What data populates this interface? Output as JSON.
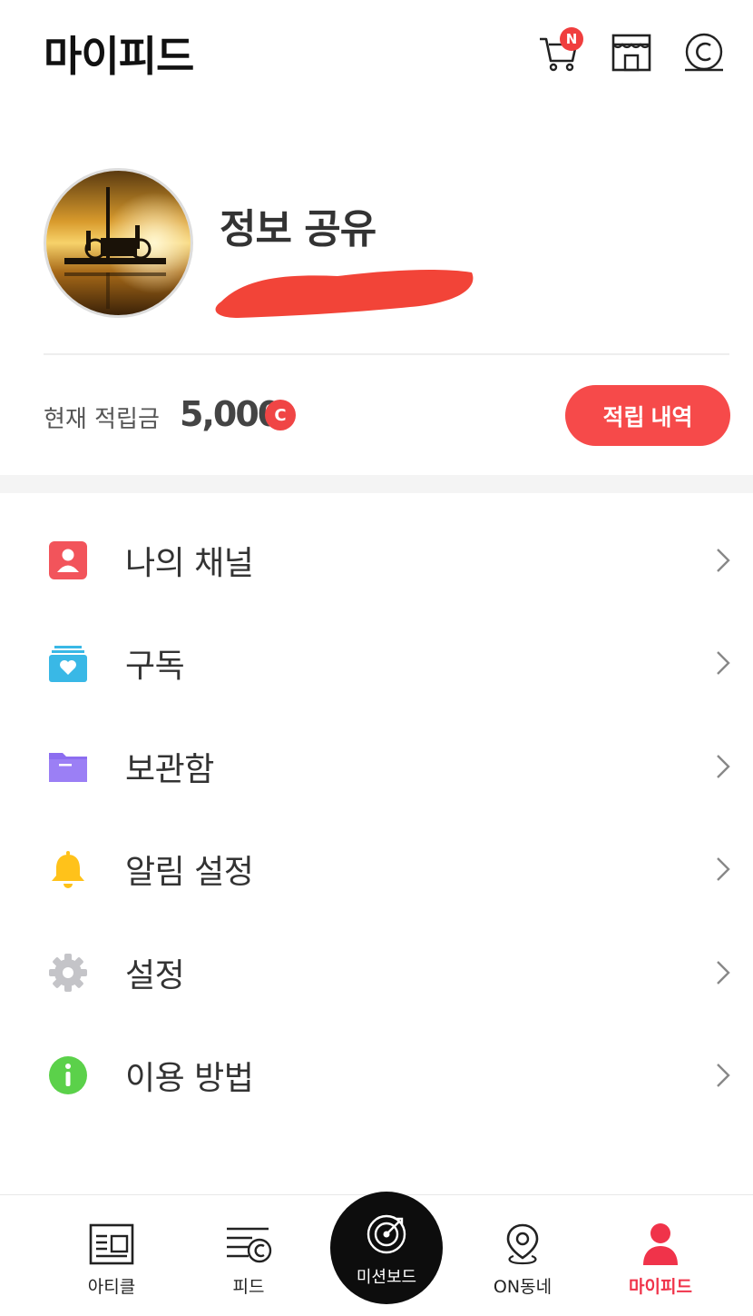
{
  "header": {
    "title": "마이피드",
    "cart_badge": "N",
    "icons": [
      "cart-icon",
      "store-icon",
      "coin-icon"
    ]
  },
  "profile": {
    "name": "정보 공유"
  },
  "points": {
    "label": "현재 적립금",
    "value": "5,000",
    "coin_symbol": "C",
    "history_button": "적립 내역"
  },
  "menu": {
    "items": [
      {
        "label": "나의 채널",
        "icon": "my-channel-icon",
        "color": "#f2545b"
      },
      {
        "label": "구독",
        "icon": "subscribe-icon",
        "color": "#39b8e6"
      },
      {
        "label": "보관함",
        "icon": "folder-icon",
        "color": "#8c6df0"
      },
      {
        "label": "알림 설정",
        "icon": "bell-icon",
        "color": "#ffc21a"
      },
      {
        "label": "설정",
        "icon": "gear-icon",
        "color": "#c4c4c8"
      },
      {
        "label": "이용 방법",
        "icon": "info-icon",
        "color": "#5bd14a"
      }
    ]
  },
  "bottom_nav": {
    "items": [
      {
        "label": "아티클",
        "icon": "article-icon"
      },
      {
        "label": "피드",
        "icon": "feed-icon"
      },
      {
        "label": "미션보드",
        "icon": "target-icon"
      },
      {
        "label": "ON동네",
        "icon": "location-pin-icon"
      },
      {
        "label": "마이피드",
        "icon": "person-icon",
        "active": true
      }
    ]
  },
  "colors": {
    "accent": "#f64a4a",
    "active_nav": "#f0334a"
  }
}
